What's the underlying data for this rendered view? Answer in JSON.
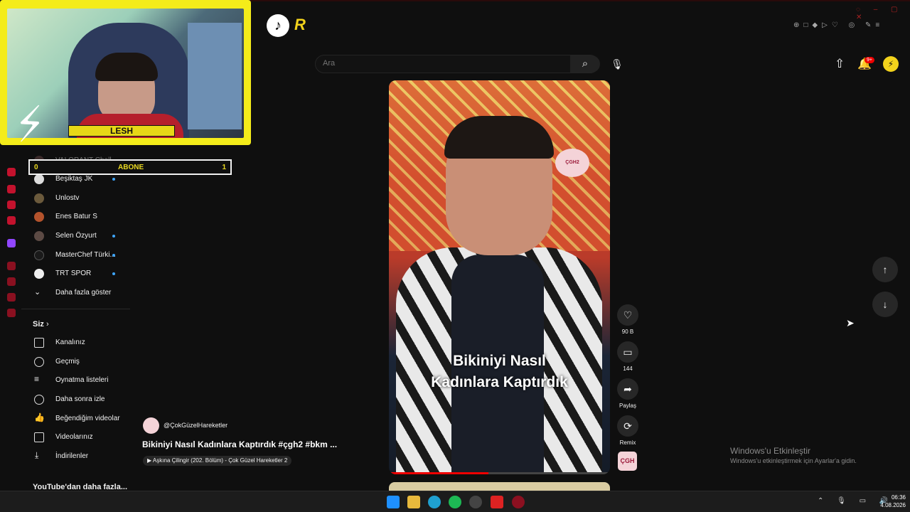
{
  "overlay": {
    "streamer_name": "LESH",
    "abone_bar": {
      "left": "0",
      "label": "ABONE",
      "right": "1"
    }
  },
  "header": {
    "search_placeholder": "Ara",
    "notification_badge": "9+"
  },
  "sidebar": {
    "subscriptions": [
      {
        "label": "VALORANT Chall...",
        "dot": false
      },
      {
        "label": "Beşiktaş JK",
        "dot": true
      },
      {
        "label": "Unlostv",
        "dot": false
      },
      {
        "label": "Enes Batur S",
        "dot": false
      },
      {
        "label": "Selen Özyurt",
        "dot": true
      },
      {
        "label": "MasterChef Türki...",
        "dot": true
      },
      {
        "label": "TRT SPOR",
        "dot": true
      },
      {
        "label": "Daha fazla göster",
        "dot": false
      }
    ],
    "you_section_title": "Siz",
    "you_items": [
      {
        "label": "Kanalınız",
        "icon": "channel-icon"
      },
      {
        "label": "Geçmiş",
        "icon": "history-icon"
      },
      {
        "label": "Oynatma listeleri",
        "icon": "playlist-icon"
      },
      {
        "label": "Daha sonra izle",
        "icon": "clock-icon"
      },
      {
        "label": "Beğendiğim videolar",
        "icon": "thumb-up-icon"
      },
      {
        "label": "Videolarınız",
        "icon": "video-icon"
      },
      {
        "label": "İndirilenler",
        "icon": "download-icon"
      }
    ],
    "more_from_youtube": "YouTube'dan daha fazla..."
  },
  "video": {
    "caption_line1": "Bikiniyi Nasıl",
    "caption_line2": "Kadınlara Kaptırdık",
    "channel": "@ÇokGüzelHareketler",
    "title": "Bikiniyi Nasıl Kadınlara Kaptırdık #çgh2 #bkm ...",
    "playlist": "▶ Aşkına Çilingir (202. Bölüm) - Çok Güzel Hareketler 2",
    "progress": 0.45
  },
  "actions": {
    "likes": "90 B",
    "comments": "144",
    "share": "Paylaş",
    "remix": "Remix"
  },
  "watermark": {
    "title": "Windows'u Etkinleştir",
    "subtitle": "Windows'u etkinleştirmek için Ayarlar'a gidin."
  },
  "taskbar": {
    "time": "06:36",
    "date": "4.08.2026"
  },
  "colors": {
    "overlay_yellow": "#f4ec1a",
    "accent_red": "#e00000",
    "link_blue": "#3ea6ff"
  }
}
